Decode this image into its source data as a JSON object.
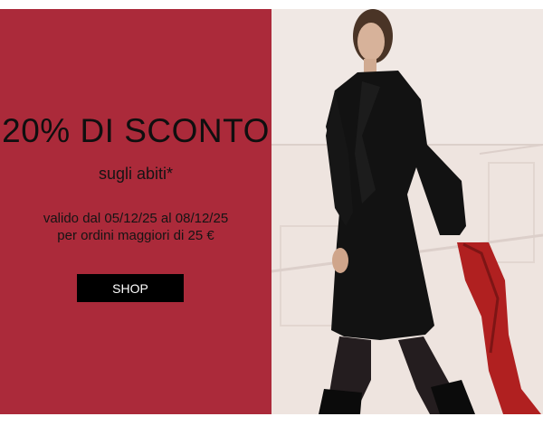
{
  "promo": {
    "headline": "20% DI SCONTO",
    "subtitle": "sugli abiti*",
    "terms_line1": "valido dal 05/12/25 al 08/12/25",
    "terms_line2": "per ordini maggiori di 25 €",
    "cta_label": "SHOP"
  },
  "colors": {
    "promo_background": "#ab2a3a",
    "cta_background": "#000000",
    "cta_text": "#ffffff",
    "photo_background": "#efe7e3",
    "dress": "#111111",
    "scarf": "#b02020"
  }
}
